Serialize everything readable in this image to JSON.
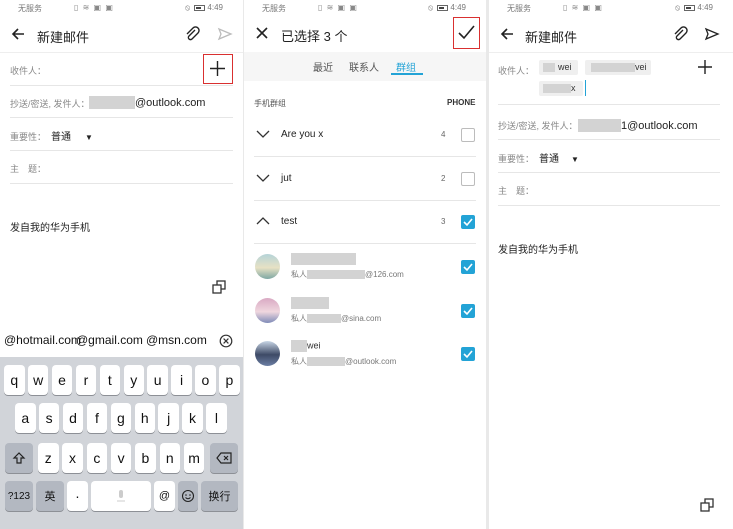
{
  "colors": {
    "accent": "#23a3d6",
    "highlight_box": "#d93030",
    "redaction": "#d3d3d3"
  },
  "status_bar": {
    "carrier": "无服务",
    "time": "4:49"
  },
  "panel1": {
    "title": "新建邮件",
    "to_label": "收件人：",
    "cc_label": "抄送/密送, 发件人：",
    "from_domain": "@outlook.com",
    "priority_label": "重要性：",
    "priority_value": "普通",
    "subject_label": "主　题：",
    "body": "发自我的华为手机",
    "suggestions": [
      "@hotmail.com",
      "@gmail.com",
      "@msn.com"
    ],
    "keyboard": {
      "row1": [
        "q",
        "w",
        "e",
        "r",
        "t",
        "y",
        "u",
        "i",
        "o",
        "p"
      ],
      "row2": [
        "a",
        "s",
        "d",
        "f",
        "g",
        "h",
        "j",
        "k",
        "l"
      ],
      "row3": [
        "z",
        "x",
        "c",
        "v",
        "b",
        "n",
        "m"
      ],
      "num_key": "?123",
      "lang_key": "英",
      "dot_key": "·",
      "at_key": "@",
      "enter_key": "换行"
    }
  },
  "panel2": {
    "title": "已选择 3 个",
    "tabs": [
      "最近",
      "联系人",
      "群组"
    ],
    "active_tab": "群组",
    "section_label": "手机群组",
    "section_right": "PHONE",
    "groups": [
      {
        "name": "Are you x",
        "count": "4",
        "checked": false
      },
      {
        "name": "jut",
        "count": "2",
        "checked": false
      },
      {
        "name": "test",
        "count": "3",
        "checked": true
      }
    ],
    "members": [
      {
        "name": "",
        "prefix": "私人",
        "domain": "@126.com",
        "checked": true
      },
      {
        "name": "",
        "prefix": "私人",
        "domain": "@sina.com",
        "checked": true
      },
      {
        "name": "wei",
        "prefix": "私人",
        "domain": "@outlook.com",
        "checked": true
      }
    ]
  },
  "panel3": {
    "title": "新建邮件",
    "to_label": "收件人：",
    "chips": [
      "wei",
      "vei",
      "x"
    ],
    "cc_label": "抄送/密送, 发件人：",
    "from_domain": "1@outlook.com",
    "priority_label": "重要性：",
    "priority_value": "普通",
    "subject_label": "主　题：",
    "body": "发自我的华为手机"
  }
}
